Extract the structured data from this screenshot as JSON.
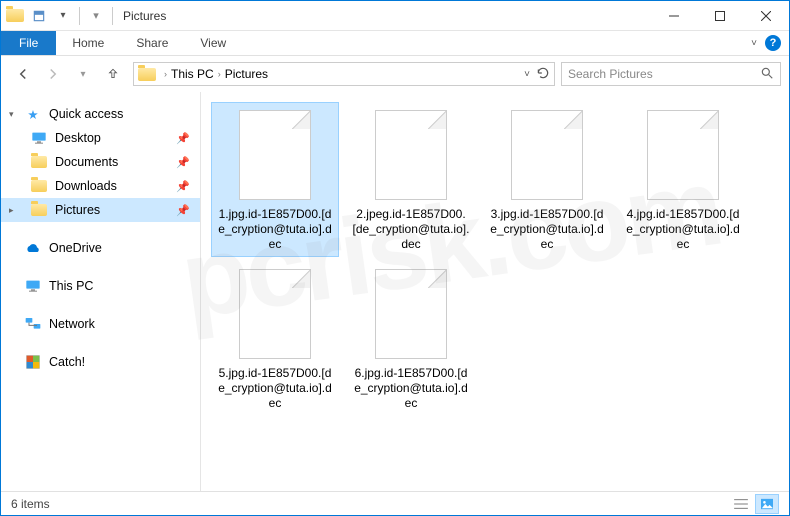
{
  "window": {
    "title": "Pictures"
  },
  "ribbon": {
    "file": "File",
    "tabs": [
      "Home",
      "Share",
      "View"
    ]
  },
  "address": {
    "crumbs": [
      "This PC",
      "Pictures"
    ]
  },
  "search": {
    "placeholder": "Search Pictures"
  },
  "sidebar": {
    "quick_access": "Quick access",
    "quick_items": [
      {
        "label": "Desktop",
        "pinned": true
      },
      {
        "label": "Documents",
        "pinned": true
      },
      {
        "label": "Downloads",
        "pinned": true
      },
      {
        "label": "Pictures",
        "pinned": true,
        "selected": true
      }
    ],
    "onedrive": "OneDrive",
    "this_pc": "This PC",
    "network": "Network",
    "catch": "Catch!"
  },
  "files": [
    {
      "name": "1.jpg.id-1E857D00.[de_cryption@tuta.io].dec",
      "selected": true
    },
    {
      "name": "2.jpeg.id-1E857D00.[de_cryption@tuta.io].dec"
    },
    {
      "name": "3.jpg.id-1E857D00.[de_cryption@tuta.io].dec"
    },
    {
      "name": "4.jpg.id-1E857D00.[de_cryption@tuta.io].dec"
    },
    {
      "name": "5.jpg.id-1E857D00.[de_cryption@tuta.io].dec"
    },
    {
      "name": "6.jpg.id-1E857D00.[de_cryption@tuta.io].dec"
    }
  ],
  "status": {
    "count": "6 items"
  },
  "watermark": "pcrisk.com"
}
